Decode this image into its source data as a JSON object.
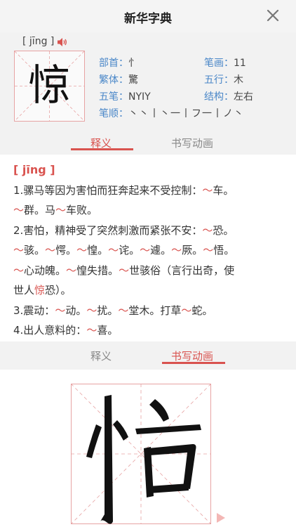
{
  "app": {
    "title": "新华字典"
  },
  "character": {
    "char": "惊",
    "pinyin_display": "[ jīng ]",
    "radical_label": "部首：",
    "radical": "忄",
    "strokes_label": "笔画：",
    "strokes": "11",
    "traditional_label": "繁体：",
    "traditional": "驚",
    "wuxing_label": "五行：",
    "wuxing": "木",
    "wubi_label": "五笔：",
    "wubi": "NYIY",
    "structure_label": "结构：",
    "structure": "左右",
    "stroke_order_label": "笔顺：",
    "stroke_order": "丶丶丨丶一丨フ一丨ノ丶"
  },
  "tabs": {
    "definition": "释义",
    "animation": "书写动画"
  },
  "definitions": {
    "pinyin_head": "[ jīng ]",
    "lines": [
      [
        {
          "t": "1.骡马等因为害怕而狂奔起来不受控制："
        },
        {
          "t": "～",
          "h": true
        },
        {
          "t": "车。"
        }
      ],
      [
        {
          "t": "～",
          "h": true
        },
        {
          "t": "群。马"
        },
        {
          "t": "～",
          "h": true
        },
        {
          "t": "车败。"
        }
      ],
      [
        {
          "t": "2.害怕，精神受了突然刺激而紧张不安："
        },
        {
          "t": "～",
          "h": true
        },
        {
          "t": "恐。"
        }
      ],
      [
        {
          "t": "～",
          "h": true
        },
        {
          "t": "骇。"
        },
        {
          "t": "～",
          "h": true
        },
        {
          "t": "愕。"
        },
        {
          "t": "～",
          "h": true
        },
        {
          "t": "惶。"
        },
        {
          "t": "～",
          "h": true
        },
        {
          "t": "诧。"
        },
        {
          "t": "～",
          "h": true
        },
        {
          "t": "遽。"
        },
        {
          "t": "～",
          "h": true
        },
        {
          "t": "厥。"
        },
        {
          "t": "～",
          "h": true
        },
        {
          "t": "悟。"
        }
      ],
      [
        {
          "t": "～",
          "h": true
        },
        {
          "t": "心动魄。"
        },
        {
          "t": "～",
          "h": true
        },
        {
          "t": "惶失措。"
        },
        {
          "t": "～",
          "h": true
        },
        {
          "t": "世骇俗（言行出奇，使"
        }
      ],
      [
        {
          "t": "世人"
        },
        {
          "t": "惊",
          "h": true
        },
        {
          "t": "恐）。"
        }
      ],
      [
        {
          "t": "3.震动："
        },
        {
          "t": "～",
          "h": true
        },
        {
          "t": "动。"
        },
        {
          "t": "～",
          "h": true
        },
        {
          "t": "扰。"
        },
        {
          "t": "～",
          "h": true
        },
        {
          "t": "堂木。打草"
        },
        {
          "t": "～",
          "h": true
        },
        {
          "t": "蛇。"
        }
      ],
      [
        {
          "t": "4.出人意料的："
        },
        {
          "t": "～",
          "h": true
        },
        {
          "t": "喜。"
        }
      ]
    ]
  },
  "animation": {
    "partial_char": "怕"
  },
  "colors": {
    "accent": "#d9534f",
    "label": "#4a87c8",
    "grid": "#e7a3a3"
  }
}
